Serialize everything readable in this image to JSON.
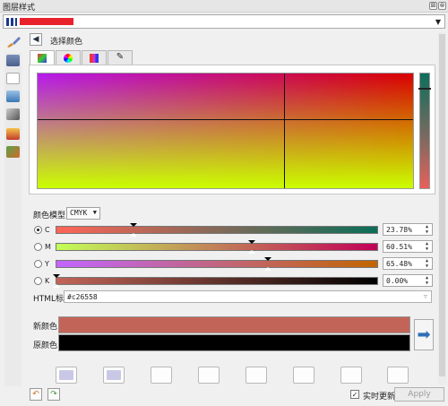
{
  "window": {
    "title": "图层样式",
    "buttons": [
      "⊠",
      "⊗"
    ]
  },
  "layer_selector": {
    "name": "layer",
    "arrow": "▼"
  },
  "panel": {
    "back": "◀",
    "title": "选择颜色"
  },
  "tabs": [
    {
      "icon": "color-ramp-icon",
      "glyph": "▦",
      "active": true
    },
    {
      "icon": "color-wheel-icon",
      "glyph": "◉",
      "active": false
    },
    {
      "icon": "palette-grid-icon",
      "glyph": "▦",
      "active": false
    },
    {
      "icon": "eyedropper-icon",
      "glyph": "✎",
      "active": false
    }
  ],
  "color_model": {
    "label": "颜色模型",
    "value": "CMYK",
    "arrow": "▼"
  },
  "channels": [
    {
      "letter": "C",
      "value": "23.78%",
      "selected": true,
      "level": 0.2378
    },
    {
      "letter": "M",
      "value": "60.51%",
      "selected": false,
      "level": 0.6051
    },
    {
      "letter": "Y",
      "value": "65.48%",
      "selected": false,
      "level": 0.6548
    },
    {
      "letter": "K",
      "value": "0.00%",
      "selected": false,
      "level": 0.0
    }
  ],
  "html": {
    "label": "HTML标记",
    "value": "#c26558",
    "arrow": "▽"
  },
  "preview": {
    "new_label": "新颜色",
    "old_label": "原颜色",
    "new_color": "#c26558",
    "old_color": "#000000",
    "arrow": "➡"
  },
  "swatches": [
    "#c8c8e6",
    "#c8c8e6",
    "",
    "",
    "",
    "",
    "",
    ""
  ],
  "footer": {
    "undo": "↶",
    "redo": "↷",
    "live_update_label": "实时更新",
    "live_update_checked": "✓",
    "apply_label": "Apply"
  }
}
